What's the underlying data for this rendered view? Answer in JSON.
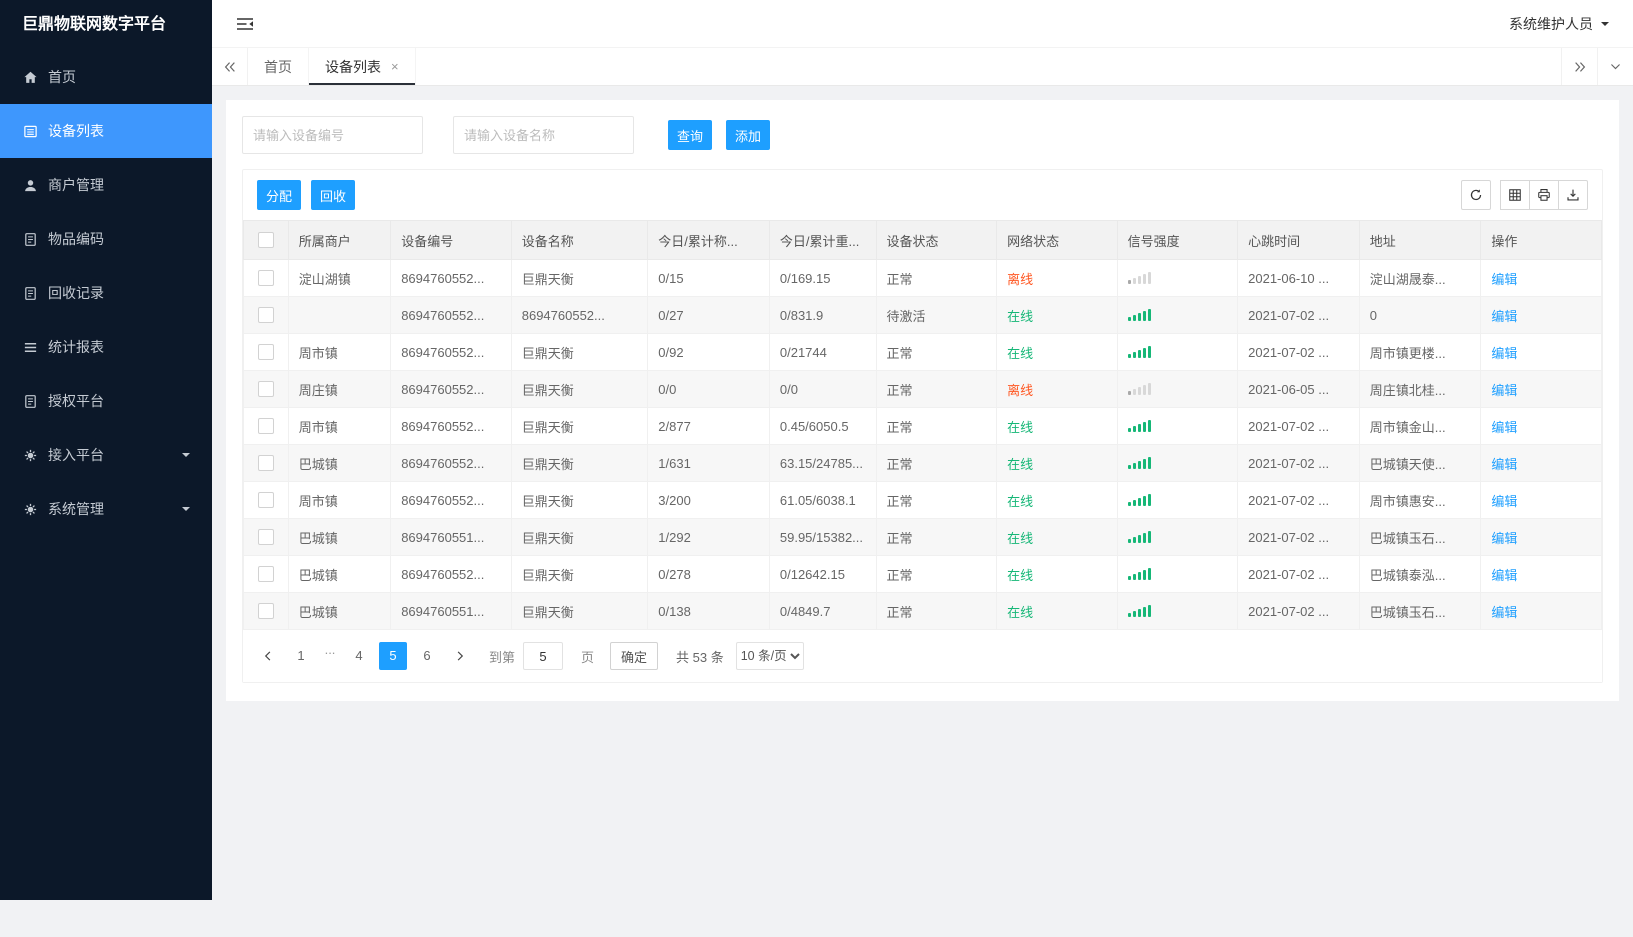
{
  "colors": {
    "accent": "#1E9FFF",
    "sidebar_active": "#3e97fd",
    "green": "#16b777",
    "red": "#ff5722",
    "sidebar_bg": "#0c1829"
  },
  "app": {
    "title": "巨鼎物联网数字平台",
    "user_role": "系统维护人员"
  },
  "sidebar": {
    "items": [
      {
        "label": "首页",
        "icon": "home-icon",
        "active": false,
        "expandable": false
      },
      {
        "label": "设备列表",
        "icon": "list-icon",
        "active": true,
        "expandable": false
      },
      {
        "label": "商户管理",
        "icon": "user-icon",
        "active": false,
        "expandable": false
      },
      {
        "label": "物品编码",
        "icon": "doc-icon",
        "active": false,
        "expandable": false
      },
      {
        "label": "回收记录",
        "icon": "doc-icon",
        "active": false,
        "expandable": false
      },
      {
        "label": "统计报表",
        "icon": "menu-icon",
        "active": false,
        "expandable": false
      },
      {
        "label": "授权平台",
        "icon": "doc-icon",
        "active": false,
        "expandable": false
      },
      {
        "label": "接入平台",
        "icon": "gear-icon",
        "active": false,
        "expandable": true
      },
      {
        "label": "系统管理",
        "icon": "gear-icon",
        "active": false,
        "expandable": true
      }
    ]
  },
  "tabbar": {
    "tabs": [
      {
        "label": "首页",
        "active": false,
        "closable": false
      },
      {
        "label": "设备列表",
        "active": true,
        "closable": true
      }
    ]
  },
  "search": {
    "device_no_placeholder": "请输入设备编号",
    "device_name_placeholder": "请输入设备名称",
    "query_label": "查询",
    "add_label": "添加"
  },
  "toolbar": {
    "allocate_label": "分配",
    "recycle_label": "回收",
    "action_icons": [
      "refresh-icon",
      "columns-icon",
      "print-icon",
      "export-icon"
    ]
  },
  "table": {
    "columns": [
      "所属商户",
      "设备编号",
      "设备名称",
      "今日/累计称...",
      "今日/累计重...",
      "设备状态",
      "网络状态",
      "信号强度",
      "心跳时间",
      "地址",
      "操作"
    ],
    "edit_label": "编辑",
    "online_text": "在线",
    "offline_text": "离线",
    "rows": [
      {
        "merchant": "淀山湖镇",
        "device_no": "8694760552...",
        "device_name": "巨鼎天衡",
        "today_count": "0/15",
        "today_weight": "0/169.15",
        "device_status": "正常",
        "network_status": "离线",
        "signal": "weak",
        "heartbeat": "2021-06-10 ...",
        "address": "淀山湖晟泰..."
      },
      {
        "merchant": "",
        "device_no": "8694760552...",
        "device_name": "8694760552...",
        "today_count": "0/27",
        "today_weight": "0/831.9",
        "device_status": "待激活",
        "network_status": "在线",
        "signal": "full",
        "heartbeat": "2021-07-02 ...",
        "address": "0"
      },
      {
        "merchant": "周市镇",
        "device_no": "8694760552...",
        "device_name": "巨鼎天衡",
        "today_count": "0/92",
        "today_weight": "0/21744",
        "device_status": "正常",
        "network_status": "在线",
        "signal": "full",
        "heartbeat": "2021-07-02 ...",
        "address": "周市镇更楼..."
      },
      {
        "merchant": "周庄镇",
        "device_no": "8694760552...",
        "device_name": "巨鼎天衡",
        "today_count": "0/0",
        "today_weight": "0/0",
        "device_status": "正常",
        "network_status": "离线",
        "signal": "weak",
        "heartbeat": "2021-06-05 ...",
        "address": "周庄镇北桂..."
      },
      {
        "merchant": "周市镇",
        "device_no": "8694760552...",
        "device_name": "巨鼎天衡",
        "today_count": "2/877",
        "today_weight": "0.45/6050.5",
        "device_status": "正常",
        "network_status": "在线",
        "signal": "full",
        "heartbeat": "2021-07-02 ...",
        "address": "周市镇金山..."
      },
      {
        "merchant": "巴城镇",
        "device_no": "8694760552...",
        "device_name": "巨鼎天衡",
        "today_count": "1/631",
        "today_weight": "63.15/24785...",
        "device_status": "正常",
        "network_status": "在线",
        "signal": "full",
        "heartbeat": "2021-07-02 ...",
        "address": "巴城镇天使..."
      },
      {
        "merchant": "周市镇",
        "device_no": "8694760552...",
        "device_name": "巨鼎天衡",
        "today_count": "3/200",
        "today_weight": "61.05/6038.1",
        "device_status": "正常",
        "network_status": "在线",
        "signal": "full",
        "heartbeat": "2021-07-02 ...",
        "address": "周市镇惠安..."
      },
      {
        "merchant": "巴城镇",
        "device_no": "8694760551...",
        "device_name": "巨鼎天衡",
        "today_count": "1/292",
        "today_weight": "59.95/15382...",
        "device_status": "正常",
        "network_status": "在线",
        "signal": "full",
        "heartbeat": "2021-07-02 ...",
        "address": "巴城镇玉石..."
      },
      {
        "merchant": "巴城镇",
        "device_no": "8694760552...",
        "device_name": "巨鼎天衡",
        "today_count": "0/278",
        "today_weight": "0/12642.15",
        "device_status": "正常",
        "network_status": "在线",
        "signal": "full",
        "heartbeat": "2021-07-02 ...",
        "address": "巴城镇泰泓..."
      },
      {
        "merchant": "巴城镇",
        "device_no": "8694760551...",
        "device_name": "巨鼎天衡",
        "today_count": "0/138",
        "today_weight": "0/4849.7",
        "device_status": "正常",
        "network_status": "在线",
        "signal": "full",
        "heartbeat": "2021-07-02 ...",
        "address": "巴城镇玉石..."
      }
    ]
  },
  "pagination": {
    "pages": [
      {
        "label": "1",
        "active": false,
        "ellipsis": false
      },
      {
        "label": "...",
        "active": false,
        "ellipsis": true
      },
      {
        "label": "4",
        "active": false,
        "ellipsis": false
      },
      {
        "label": "5",
        "active": true,
        "ellipsis": false
      },
      {
        "label": "6",
        "active": false,
        "ellipsis": false
      }
    ],
    "goto_prefix": "到第",
    "goto_value": "5",
    "goto_suffix": "页",
    "confirm_label": "确定",
    "total_text": "共 53 条",
    "per_page": "10 条/页"
  }
}
